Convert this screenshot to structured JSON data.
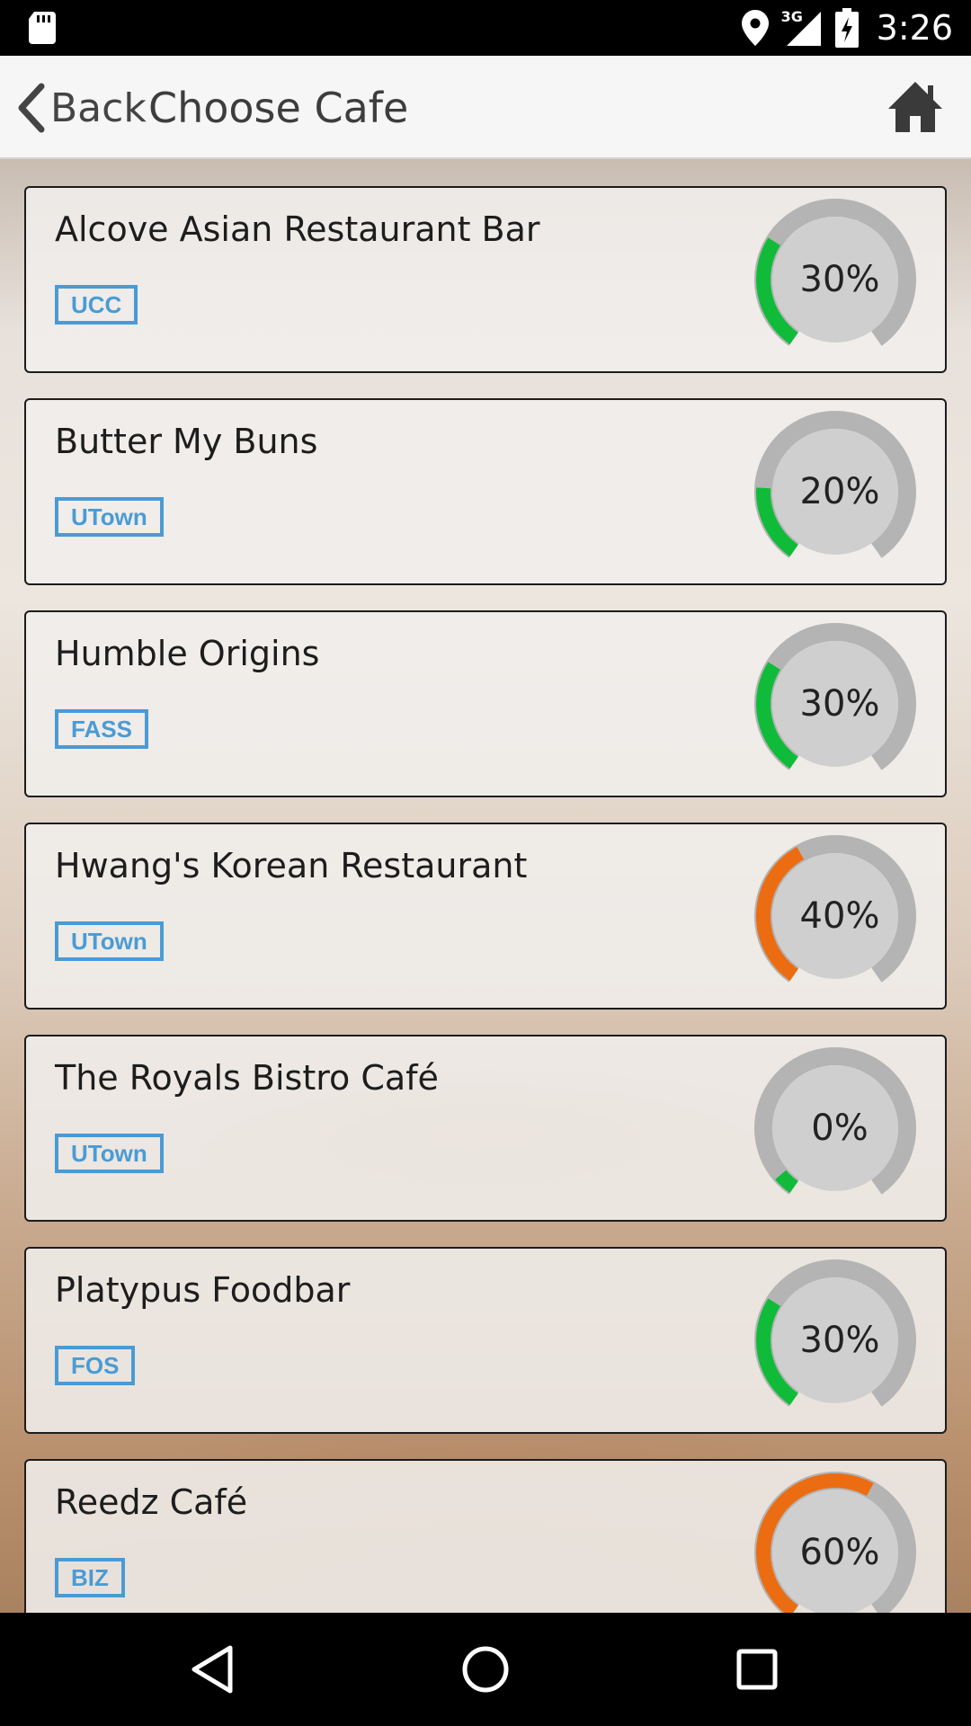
{
  "status_bar": {
    "time": "3:26",
    "network": "3G",
    "icons": [
      "sd-card-icon",
      "location-icon",
      "signal-icon",
      "battery-icon"
    ]
  },
  "app_bar": {
    "back_label": "Back",
    "title": "Choose Cafe",
    "home_icon": "home-icon"
  },
  "colors": {
    "tag_blue": "#4a9bd5",
    "gauge_green": "#10bb3a",
    "gauge_orange": "#ec6c12",
    "gauge_track": "#b4b4b4",
    "gauge_face": "#cfcfcf"
  },
  "cafes": [
    {
      "name": "Alcove Asian Restaurant Bar",
      "tag": "UCC",
      "percent_label": "30%",
      "level": 0.3,
      "color": "green"
    },
    {
      "name": "Butter My Buns",
      "tag": "UTown",
      "percent_label": "20%",
      "level": 0.2,
      "color": "green"
    },
    {
      "name": "Humble Origins",
      "tag": "FASS",
      "percent_label": "30%",
      "level": 0.3,
      "color": "green"
    },
    {
      "name": "Hwang's Korean Restaurant",
      "tag": "UTown",
      "percent_label": "40%",
      "level": 0.4,
      "color": "orange"
    },
    {
      "name": "The Royals Bistro Café",
      "tag": "UTown",
      "percent_label": "0%",
      "level": 0.0,
      "color": "green"
    },
    {
      "name": "Platypus Foodbar",
      "tag": "FOS",
      "percent_label": "30%",
      "level": 0.3,
      "color": "green"
    },
    {
      "name": "Reedz Café",
      "tag": "BIZ",
      "percent_label": "60%",
      "level": 0.6,
      "color": "orange"
    }
  ],
  "nav_bar": {
    "buttons": [
      "back-triangle-icon",
      "home-circle-icon",
      "recents-square-icon"
    ]
  }
}
